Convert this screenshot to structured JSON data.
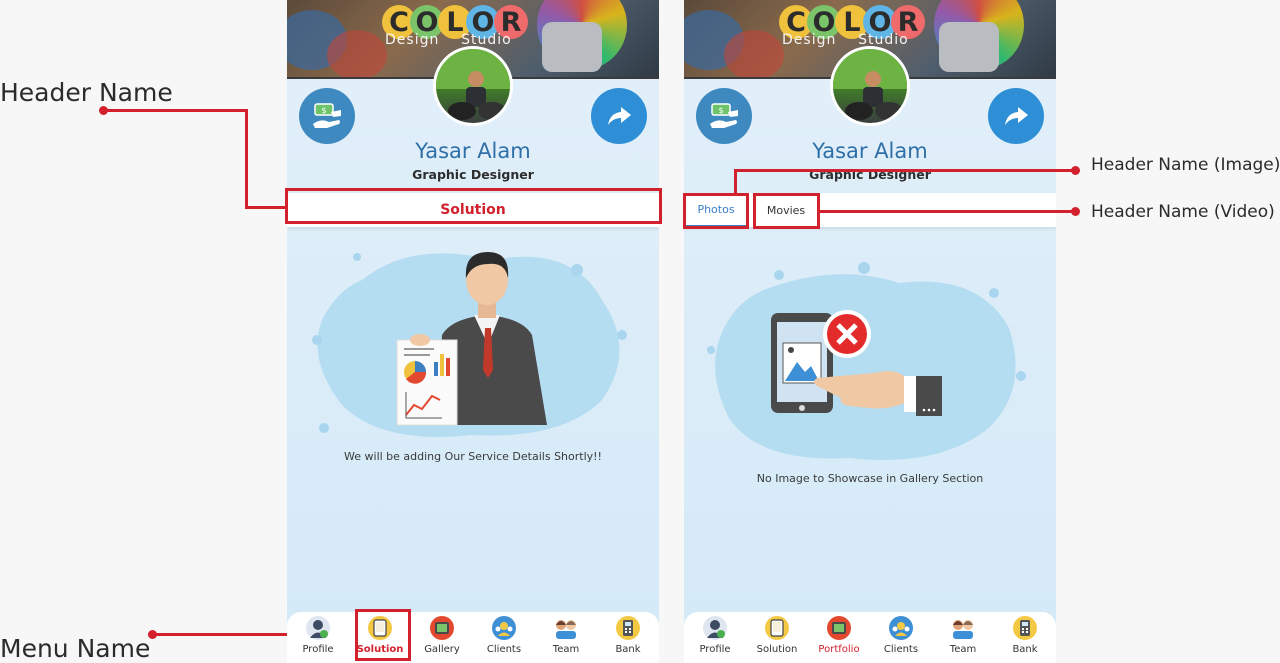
{
  "annotations": {
    "left_header": "Header Name",
    "left_menu": "Menu Name",
    "right_image": "Header Name (Image)",
    "right_video": "Header Name (Video)"
  },
  "cover": {
    "title_letters": [
      "C",
      "O",
      "L",
      "O",
      "R"
    ],
    "letter_colors": [
      "#f0c13c",
      "#7cc46a",
      "#f0c13c",
      "#5fb5e6",
      "#ef6b6b"
    ],
    "subtitle": "Design    Studio"
  },
  "profile": {
    "name": "Yasar Alam",
    "role": "Graphic Designer"
  },
  "left_screen": {
    "header_title": "Solution",
    "message": "We will be adding Our Service Details Shortly!!",
    "active_nav": "Solution"
  },
  "right_screen": {
    "tabs": [
      "Photos",
      "Movies"
    ],
    "active_tab": "Photos",
    "message": "No Image to Showcase in Gallery Section",
    "active_nav": "Portfolio"
  },
  "nav_left": [
    {
      "label": "Profile",
      "icon": "profile-icon",
      "color": "#3d4b63"
    },
    {
      "label": "Solution",
      "icon": "solution-icon",
      "color": "#f3c843"
    },
    {
      "label": "Gallery",
      "icon": "gallery-icon",
      "color": "#e2492f"
    },
    {
      "label": "Clients",
      "icon": "clients-icon",
      "color": "#3d8fd6"
    },
    {
      "label": "Team",
      "icon": "team-icon",
      "color": "#8a6a55"
    },
    {
      "label": "Bank",
      "icon": "bank-icon",
      "color": "#f3c843"
    }
  ],
  "nav_right": [
    {
      "label": "Profile",
      "icon": "profile-icon",
      "color": "#3d4b63"
    },
    {
      "label": "Solution",
      "icon": "solution-icon",
      "color": "#f3c843"
    },
    {
      "label": "Portfolio",
      "icon": "portfolio-icon",
      "color": "#e2492f"
    },
    {
      "label": "Clients",
      "icon": "clients-icon",
      "color": "#3d8fd6"
    },
    {
      "label": "Team",
      "icon": "team-icon",
      "color": "#8a6a55"
    },
    {
      "label": "Bank",
      "icon": "bank-icon",
      "color": "#f3c843"
    }
  ],
  "colors": {
    "accent_red": "#d2202c",
    "name_blue": "#2f6fa8",
    "tab_blue": "#3b7ecb",
    "share_blue": "#2f8fd6"
  }
}
